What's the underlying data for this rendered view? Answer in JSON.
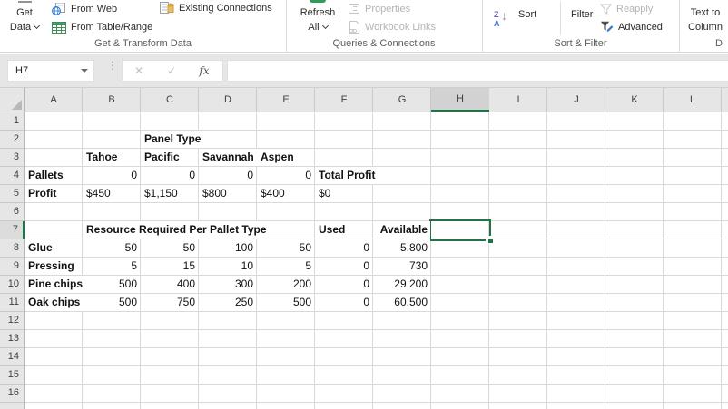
{
  "ribbon": {
    "get_data": {
      "line1": "Get",
      "line2": "Data"
    },
    "buttons": {
      "from_web": "From Web",
      "from_table_range": "From Table/Range",
      "existing_connections": "Existing Connections",
      "refresh_line1": "Refresh",
      "refresh_line2": "All",
      "properties": "Properties",
      "workbook_links": "Workbook Links",
      "sort": "Sort",
      "filter": "Filter",
      "reapply": "Reapply",
      "advanced": "Advanced",
      "text_to_columns_line1": "Text to",
      "text_to_columns_line2": "Column"
    },
    "groups": {
      "get_transform": "Get & Transform Data",
      "queries_connections": "Queries & Connections",
      "sort_filter": "Sort & Filter",
      "data_tools": "D"
    },
    "sort_icon": {
      "z": "Z",
      "a": "A",
      "arrow": "↓"
    }
  },
  "formula_bar": {
    "name_box": "H7",
    "dots": "⋮",
    "cancel_icon": "✕",
    "enter_icon": "✓",
    "fx_label": "fx",
    "formula_value": ""
  },
  "sheet": {
    "selected_cell": "H7",
    "columns": [
      "A",
      "B",
      "C",
      "D",
      "E",
      "F",
      "G",
      "H",
      "I",
      "J",
      "K",
      "L"
    ],
    "rows": [
      "1",
      "2",
      "3",
      "4",
      "5",
      "6",
      "7",
      "8",
      "9",
      "10",
      "11",
      "12",
      "13",
      "14",
      "15",
      "16"
    ],
    "selected_column": "H",
    "selected_row": 7,
    "cells": [
      {
        "col": "C",
        "row": 2,
        "value": "Panel Type",
        "bold": true,
        "align": "left"
      },
      {
        "col": "B",
        "row": 3,
        "value": "Tahoe",
        "bold": true,
        "align": "left"
      },
      {
        "col": "C",
        "row": 3,
        "value": "Pacific",
        "bold": true,
        "align": "left"
      },
      {
        "col": "D",
        "row": 3,
        "value": "Savannah",
        "bold": true,
        "align": "left"
      },
      {
        "col": "E",
        "row": 3,
        "value": "Aspen",
        "bold": true,
        "align": "left"
      },
      {
        "col": "A",
        "row": 4,
        "value": "Pallets",
        "bold": true,
        "align": "left"
      },
      {
        "col": "B",
        "row": 4,
        "value": "0",
        "bold": false,
        "align": "right"
      },
      {
        "col": "C",
        "row": 4,
        "value": "0",
        "bold": false,
        "align": "right"
      },
      {
        "col": "D",
        "row": 4,
        "value": "0",
        "bold": false,
        "align": "right"
      },
      {
        "col": "E",
        "row": 4,
        "value": "0",
        "bold": false,
        "align": "right"
      },
      {
        "col": "F",
        "row": 4,
        "value": "Total Profit",
        "bold": true,
        "align": "left"
      },
      {
        "col": "A",
        "row": 5,
        "value": "Profit",
        "bold": true,
        "align": "left"
      },
      {
        "col": "B",
        "row": 5,
        "value": "$450",
        "bold": false,
        "align": "left"
      },
      {
        "col": "C",
        "row": 5,
        "value": "$1,150",
        "bold": false,
        "align": "left"
      },
      {
        "col": "D",
        "row": 5,
        "value": "$800",
        "bold": false,
        "align": "left"
      },
      {
        "col": "E",
        "row": 5,
        "value": "$400",
        "bold": false,
        "align": "left"
      },
      {
        "col": "F",
        "row": 5,
        "value": "$0",
        "bold": false,
        "align": "left"
      },
      {
        "col": "B",
        "row": 7,
        "value": "Resource Required Per Pallet Type",
        "bold": true,
        "align": "left"
      },
      {
        "col": "F",
        "row": 7,
        "value": "Used",
        "bold": true,
        "align": "left"
      },
      {
        "col": "G",
        "row": 7,
        "value": "Available",
        "bold": true,
        "align": "right"
      },
      {
        "col": "A",
        "row": 8,
        "value": "Glue",
        "bold": true,
        "align": "left"
      },
      {
        "col": "B",
        "row": 8,
        "value": "50",
        "bold": false,
        "align": "right"
      },
      {
        "col": "C",
        "row": 8,
        "value": "50",
        "bold": false,
        "align": "right"
      },
      {
        "col": "D",
        "row": 8,
        "value": "100",
        "bold": false,
        "align": "right"
      },
      {
        "col": "E",
        "row": 8,
        "value": "50",
        "bold": false,
        "align": "right"
      },
      {
        "col": "F",
        "row": 8,
        "value": "0",
        "bold": false,
        "align": "right"
      },
      {
        "col": "G",
        "row": 8,
        "value": "5,800",
        "bold": false,
        "align": "right"
      },
      {
        "col": "A",
        "row": 9,
        "value": "Pressing",
        "bold": true,
        "align": "left"
      },
      {
        "col": "B",
        "row": 9,
        "value": "5",
        "bold": false,
        "align": "right"
      },
      {
        "col": "C",
        "row": 9,
        "value": "15",
        "bold": false,
        "align": "right"
      },
      {
        "col": "D",
        "row": 9,
        "value": "10",
        "bold": false,
        "align": "right"
      },
      {
        "col": "E",
        "row": 9,
        "value": "5",
        "bold": false,
        "align": "right"
      },
      {
        "col": "F",
        "row": 9,
        "value": "0",
        "bold": false,
        "align": "right"
      },
      {
        "col": "G",
        "row": 9,
        "value": "730",
        "bold": false,
        "align": "right"
      },
      {
        "col": "A",
        "row": 10,
        "value": "Pine chips",
        "bold": true,
        "align": "left"
      },
      {
        "col": "B",
        "row": 10,
        "value": "500",
        "bold": false,
        "align": "right"
      },
      {
        "col": "C",
        "row": 10,
        "value": "400",
        "bold": false,
        "align": "right"
      },
      {
        "col": "D",
        "row": 10,
        "value": "300",
        "bold": false,
        "align": "right"
      },
      {
        "col": "E",
        "row": 10,
        "value": "200",
        "bold": false,
        "align": "right"
      },
      {
        "col": "F",
        "row": 10,
        "value": "0",
        "bold": false,
        "align": "right"
      },
      {
        "col": "G",
        "row": 10,
        "value": "29,200",
        "bold": false,
        "align": "right"
      },
      {
        "col": "A",
        "row": 11,
        "value": "Oak chips",
        "bold": true,
        "align": "left"
      },
      {
        "col": "B",
        "row": 11,
        "value": "500",
        "bold": false,
        "align": "right"
      },
      {
        "col": "C",
        "row": 11,
        "value": "750",
        "bold": false,
        "align": "right"
      },
      {
        "col": "D",
        "row": 11,
        "value": "250",
        "bold": false,
        "align": "right"
      },
      {
        "col": "E",
        "row": 11,
        "value": "500",
        "bold": false,
        "align": "right"
      },
      {
        "col": "F",
        "row": 11,
        "value": "0",
        "bold": false,
        "align": "right"
      },
      {
        "col": "G",
        "row": 11,
        "value": "60,500",
        "bold": false,
        "align": "right"
      }
    ]
  },
  "colors": {
    "selection_green": "#217346",
    "header_accent_green": "#107C41",
    "table_icon_green": "#3c8c5c",
    "web_icon_blue": "#2b7cd3",
    "connection_amber": "#e8c06a"
  }
}
